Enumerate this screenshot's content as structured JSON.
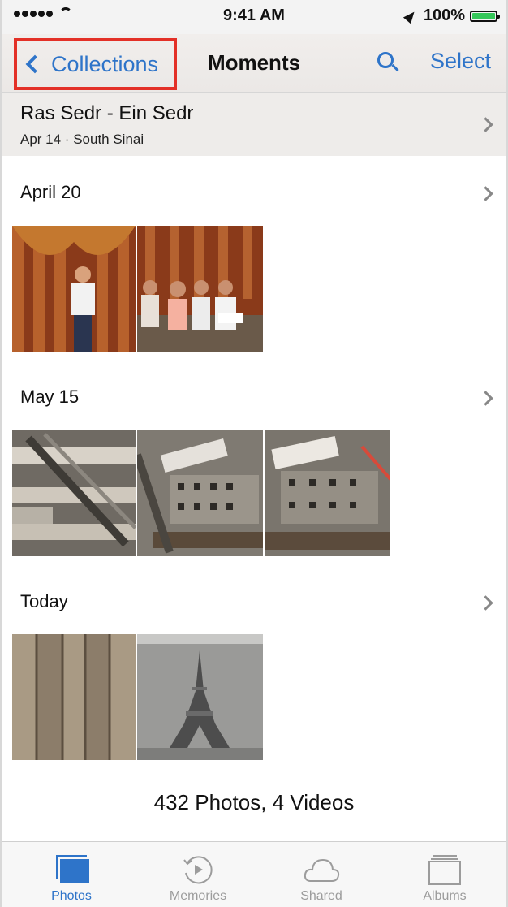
{
  "status_bar": {
    "time": "9:41 AM",
    "battery": "100%",
    "battery_level": 1.0
  },
  "nav": {
    "back_label": "Collections",
    "title": "Moments",
    "select_label": "Select",
    "search_icon": "search-icon"
  },
  "collection": {
    "title": "Ras Sedr - Ein Sedr",
    "subtitle": "Apr 14 · South Sinai"
  },
  "sections": [
    {
      "label": "April 20",
      "photos": [
        "curtain-stage-girl",
        "stage-group-girls"
      ]
    },
    {
      "label": "May 15",
      "photos": [
        "mall-interior-escalators",
        "mall-food-court-aerial",
        "mall-food-court-aerial-2"
      ]
    },
    {
      "label": "Today",
      "photos": [
        "wooden-planks",
        "eiffel-tower-figurine"
      ]
    }
  ],
  "footer": {
    "count": "432 Photos, 4 Videos"
  },
  "tabs": [
    {
      "label": "Photos",
      "icon": "photos-icon",
      "active": true
    },
    {
      "label": "Memories",
      "icon": "memories-icon",
      "active": false
    },
    {
      "label": "Shared",
      "icon": "cloud-icon",
      "active": false
    },
    {
      "label": "Albums",
      "icon": "albums-icon",
      "active": false
    }
  ],
  "colors": {
    "accent": "#2e74c9",
    "highlight_box": "#e33027"
  }
}
